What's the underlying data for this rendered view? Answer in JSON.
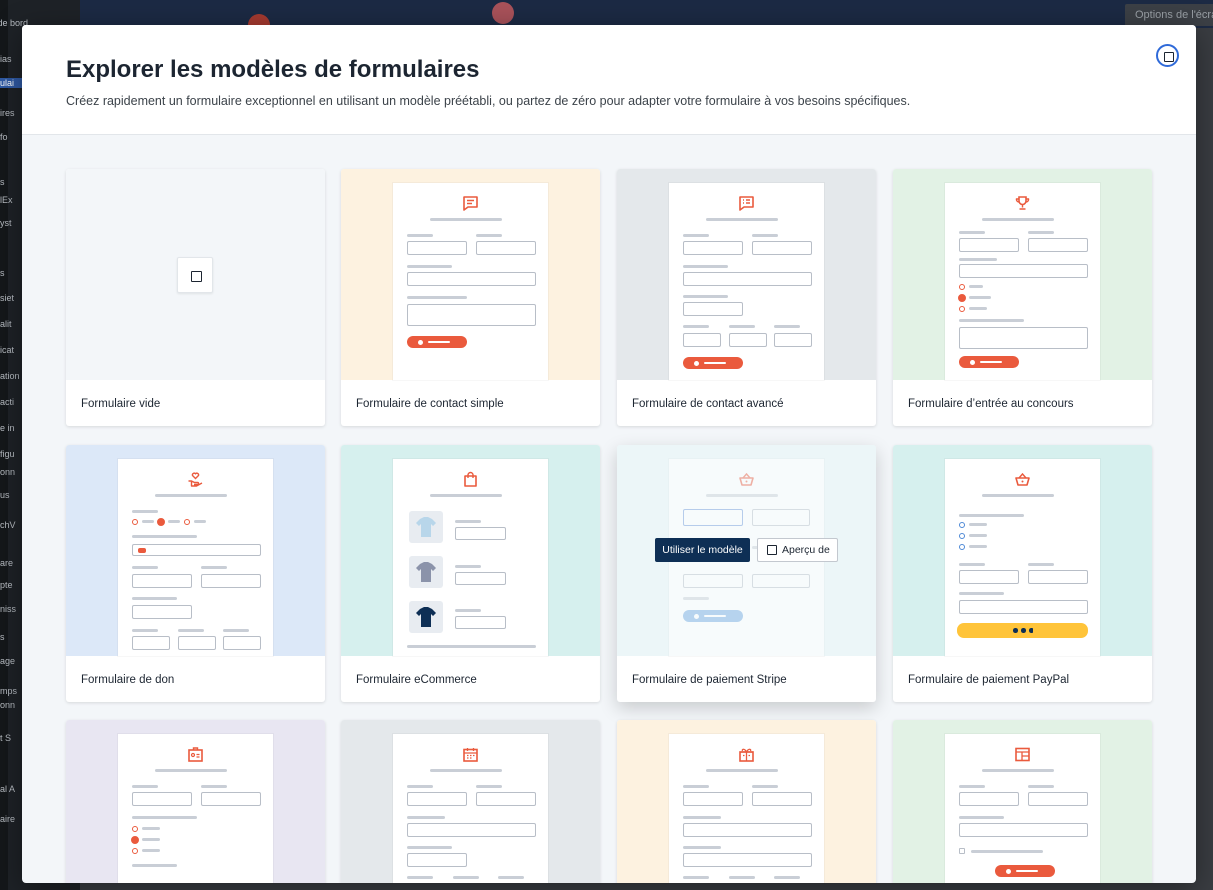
{
  "background": {
    "screen_options": "Options de l'écran",
    "sidebar_fragments": [
      "eau de bord",
      "ias",
      "ulai",
      "ires",
      "fo",
      "s",
      "lEx",
      "yst",
      "s",
      "siet",
      "alit",
      "icat",
      "ation",
      "acti",
      "e in",
      "figu",
      "onn",
      "us",
      "chV",
      "are",
      "pte",
      "niss",
      "s",
      "age",
      "mps",
      "onn",
      "t S",
      "al A",
      "aire"
    ],
    "active_sidebar_index": 2
  },
  "modal": {
    "title": "Explorer les modèles de formulaires",
    "subtitle": "Créez rapidement un formulaire exceptionnel en utilisant un modèle préétabli, ou partez de zéro pour adapter votre formulaire à vos besoins spécifiques.",
    "close_icon": "close-square-icon",
    "hover_actions": {
      "use_template": "Utiliser le modèle",
      "preview": "Aperçu de"
    },
    "templates": [
      {
        "label": "Formulaire vide",
        "bg": "#f3f6f9",
        "icon": "blank-square-icon"
      },
      {
        "label": "Formulaire de contact simple",
        "bg": "#fdf2e0",
        "icon": "chat-bubble-icon"
      },
      {
        "label": "Formulaire de contact avancé",
        "bg": "#e4e8eb",
        "icon": "chat-list-icon"
      },
      {
        "label": "Formulaire d’entrée au concours",
        "bg": "#e2f2e5",
        "icon": "trophy-icon"
      },
      {
        "label": "Formulaire de don",
        "bg": "#dce8f8",
        "icon": "heart-hand-icon"
      },
      {
        "label": "Formulaire eCommerce",
        "bg": "#d6f0ee",
        "icon": "shopping-bag-icon"
      },
      {
        "label": "Formulaire de paiement Stripe",
        "bg": "#e6f4f6",
        "icon": "basket-icon"
      },
      {
        "label": "Formulaire de paiement PayPal",
        "bg": "#d6f0ee",
        "icon": "basket-icon"
      },
      {
        "label": "",
        "bg": "#e8e6f2",
        "icon": "id-badge-icon"
      },
      {
        "label": "",
        "bg": "#e4e8eb",
        "icon": "calendar-icon"
      },
      {
        "label": "",
        "bg": "#fdf2e0",
        "icon": "gift-icon"
      },
      {
        "label": "",
        "bg": "#e2f2e5",
        "icon": "layout-window-icon"
      }
    ]
  },
  "colors": {
    "accent": "#ea5a3d",
    "primary_dark": "#0e2f55",
    "focus_blue": "#2f6ad9",
    "paypal_yellow": "#ffc43a"
  }
}
